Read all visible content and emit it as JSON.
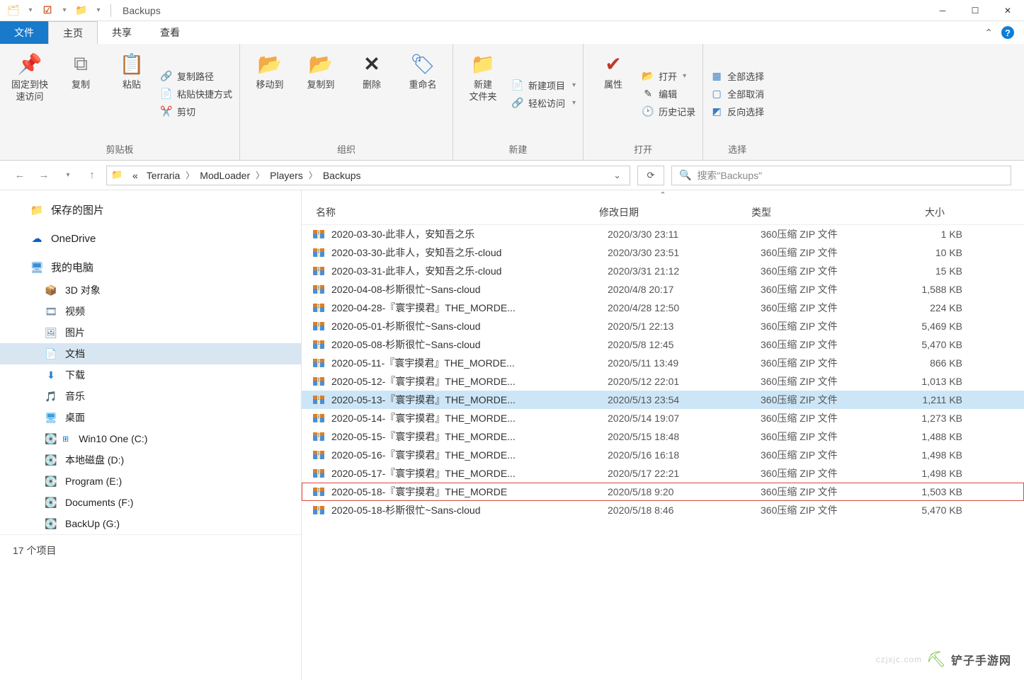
{
  "window": {
    "title": "Backups"
  },
  "tabs": {
    "file": "文件",
    "home": "主页",
    "share": "共享",
    "view": "查看"
  },
  "ribbon": {
    "clipboard": {
      "label": "剪贴板",
      "pin": "固定到快\n速访问",
      "copy": "复制",
      "paste": "粘贴",
      "copy_path": "复制路径",
      "paste_shortcut": "粘贴快捷方式",
      "cut": "剪切"
    },
    "organize": {
      "label": "组织",
      "moveto": "移动到",
      "copyto": "复制到",
      "delete": "删除",
      "rename": "重命名"
    },
    "new": {
      "label": "新建",
      "newfolder": "新建\n文件夹",
      "newitem": "新建项目",
      "easyaccess": "轻松访问"
    },
    "open": {
      "label": "打开",
      "properties": "属性",
      "open": "打开",
      "edit": "编辑",
      "history": "历史记录"
    },
    "select": {
      "label": "选择",
      "selectall": "全部选择",
      "selectnone": "全部取消",
      "invert": "反向选择"
    }
  },
  "breadcrumbs": {
    "prefix": "«",
    "items": [
      "Terraria",
      "ModLoader",
      "Players",
      "Backups"
    ]
  },
  "search": {
    "placeholder": "搜索\"Backups\""
  },
  "nav": {
    "saved_pictures": "保存的图片",
    "onedrive": "OneDrive",
    "thispc": "我的电脑",
    "items": [
      {
        "icon": "cube",
        "color": "#39a0d6",
        "label": "3D 对象"
      },
      {
        "icon": "film",
        "color": "#5b7a99",
        "label": "视频"
      },
      {
        "icon": "picture",
        "color": "#5b7a99",
        "label": "图片"
      },
      {
        "icon": "doc",
        "color": "#5b7a99",
        "label": "文档",
        "selected": true
      },
      {
        "icon": "download",
        "color": "#2e7cd6",
        "label": "下载"
      },
      {
        "icon": "music",
        "color": "#2e9ad6",
        "label": "音乐"
      },
      {
        "icon": "desktop",
        "color": "#3aa0e0",
        "label": "桌面"
      },
      {
        "icon": "drive",
        "color": "#888",
        "label": "Win10 One (C:)",
        "win": true
      },
      {
        "icon": "drive",
        "color": "#888",
        "label": "本地磁盘 (D:)"
      },
      {
        "icon": "drive",
        "color": "#888",
        "label": "Program (E:)"
      },
      {
        "icon": "drive",
        "color": "#888",
        "label": "Documents (F:)"
      },
      {
        "icon": "drive",
        "color": "#888",
        "label": "BackUp (G:)"
      }
    ],
    "footer": "17 个项目"
  },
  "columns": {
    "name": "名称",
    "date": "修改日期",
    "type": "类型",
    "size": "大小"
  },
  "files": [
    {
      "name": "2020-03-30-此非人，安知吾之乐",
      "date": "2020/3/30 23:11",
      "type": "360压缩 ZIP 文件",
      "size": "1 KB"
    },
    {
      "name": "2020-03-30-此非人，安知吾之乐-cloud",
      "date": "2020/3/30 23:51",
      "type": "360压缩 ZIP 文件",
      "size": "10 KB"
    },
    {
      "name": "2020-03-31-此非人，安知吾之乐-cloud",
      "date": "2020/3/31 21:12",
      "type": "360压缩 ZIP 文件",
      "size": "15 KB"
    },
    {
      "name": "2020-04-08-杉斯很忙~Sans-cloud",
      "date": "2020/4/8 20:17",
      "type": "360压缩 ZIP 文件",
      "size": "1,588 KB"
    },
    {
      "name": "2020-04-28-『寰宇摸君』THE_MORDE...",
      "date": "2020/4/28 12:50",
      "type": "360压缩 ZIP 文件",
      "size": "224 KB"
    },
    {
      "name": "2020-05-01-杉斯很忙~Sans-cloud",
      "date": "2020/5/1 22:13",
      "type": "360压缩 ZIP 文件",
      "size": "5,469 KB"
    },
    {
      "name": "2020-05-08-杉斯很忙~Sans-cloud",
      "date": "2020/5/8 12:45",
      "type": "360压缩 ZIP 文件",
      "size": "5,470 KB"
    },
    {
      "name": "2020-05-11-『寰宇摸君』THE_MORDE...",
      "date": "2020/5/11 13:49",
      "type": "360压缩 ZIP 文件",
      "size": "866 KB"
    },
    {
      "name": "2020-05-12-『寰宇摸君』THE_MORDE...",
      "date": "2020/5/12 22:01",
      "type": "360压缩 ZIP 文件",
      "size": "1,013 KB"
    },
    {
      "name": "2020-05-13-『寰宇摸君』THE_MORDE...",
      "date": "2020/5/13 23:54",
      "type": "360压缩 ZIP 文件",
      "size": "1,211 KB",
      "hover": true
    },
    {
      "name": "2020-05-14-『寰宇摸君』THE_MORDE...",
      "date": "2020/5/14 19:07",
      "type": "360压缩 ZIP 文件",
      "size": "1,273 KB"
    },
    {
      "name": "2020-05-15-『寰宇摸君』THE_MORDE...",
      "date": "2020/5/15 18:48",
      "type": "360压缩 ZIP 文件",
      "size": "1,488 KB"
    },
    {
      "name": "2020-05-16-『寰宇摸君』THE_MORDE...",
      "date": "2020/5/16 16:18",
      "type": "360压缩 ZIP 文件",
      "size": "1,498 KB"
    },
    {
      "name": "2020-05-17-『寰宇摸君』THE_MORDE...",
      "date": "2020/5/17 22:21",
      "type": "360压缩 ZIP 文件",
      "size": "1,498 KB"
    },
    {
      "name": "2020-05-18-『寰宇摸君』THE_MORDE",
      "date": "2020/5/18 9:20",
      "type": "360压缩 ZIP 文件",
      "size": "1,503 KB",
      "boxed": true
    },
    {
      "name": "2020-05-18-杉斯很忙~Sans-cloud",
      "date": "2020/5/18 8:46",
      "type": "360压缩 ZIP 文件",
      "size": "5,470 KB"
    }
  ],
  "watermark": {
    "text": "czjxjc.com",
    "brand": "铲子手游网"
  }
}
